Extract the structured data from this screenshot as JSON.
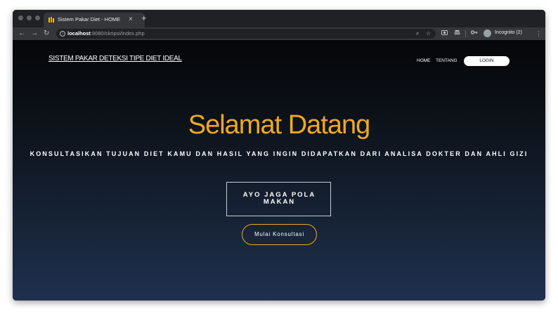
{
  "browser": {
    "tab_title": "Sistem Pakar Diet - HOME",
    "tab_close": "×",
    "new_tab": "+",
    "url_host": "localhost",
    "url_rest": ":8080/skripsi/index.php",
    "incognito_label": "Incognito (2)",
    "icons": {
      "back": "←",
      "forward": "→",
      "reload": "↻",
      "search": "⌕",
      "star": "☆",
      "menu": "⋮"
    }
  },
  "site": {
    "brand": "SISTEM PAKAR DETEKSI TIPE DIET IDEAL",
    "nav": {
      "home": "HOME",
      "about": "TENTANG",
      "login": "LOGIN"
    },
    "hero": {
      "title": "Selamat Datang",
      "subtitle": "KONSULTASIKAN TUJUAN DIET KAMU DAN HASIL YANG INGIN DIDAPATKAN DARI ANALISA DOKTER DAN AHLI GIZI",
      "box_button": "AYO JAGA POLA MAKAN",
      "cta_button": "Mulai Konsultasi"
    }
  },
  "colors": {
    "accent": "#f0a823",
    "page_top": "#050608",
    "page_bottom": "#1f3150"
  }
}
